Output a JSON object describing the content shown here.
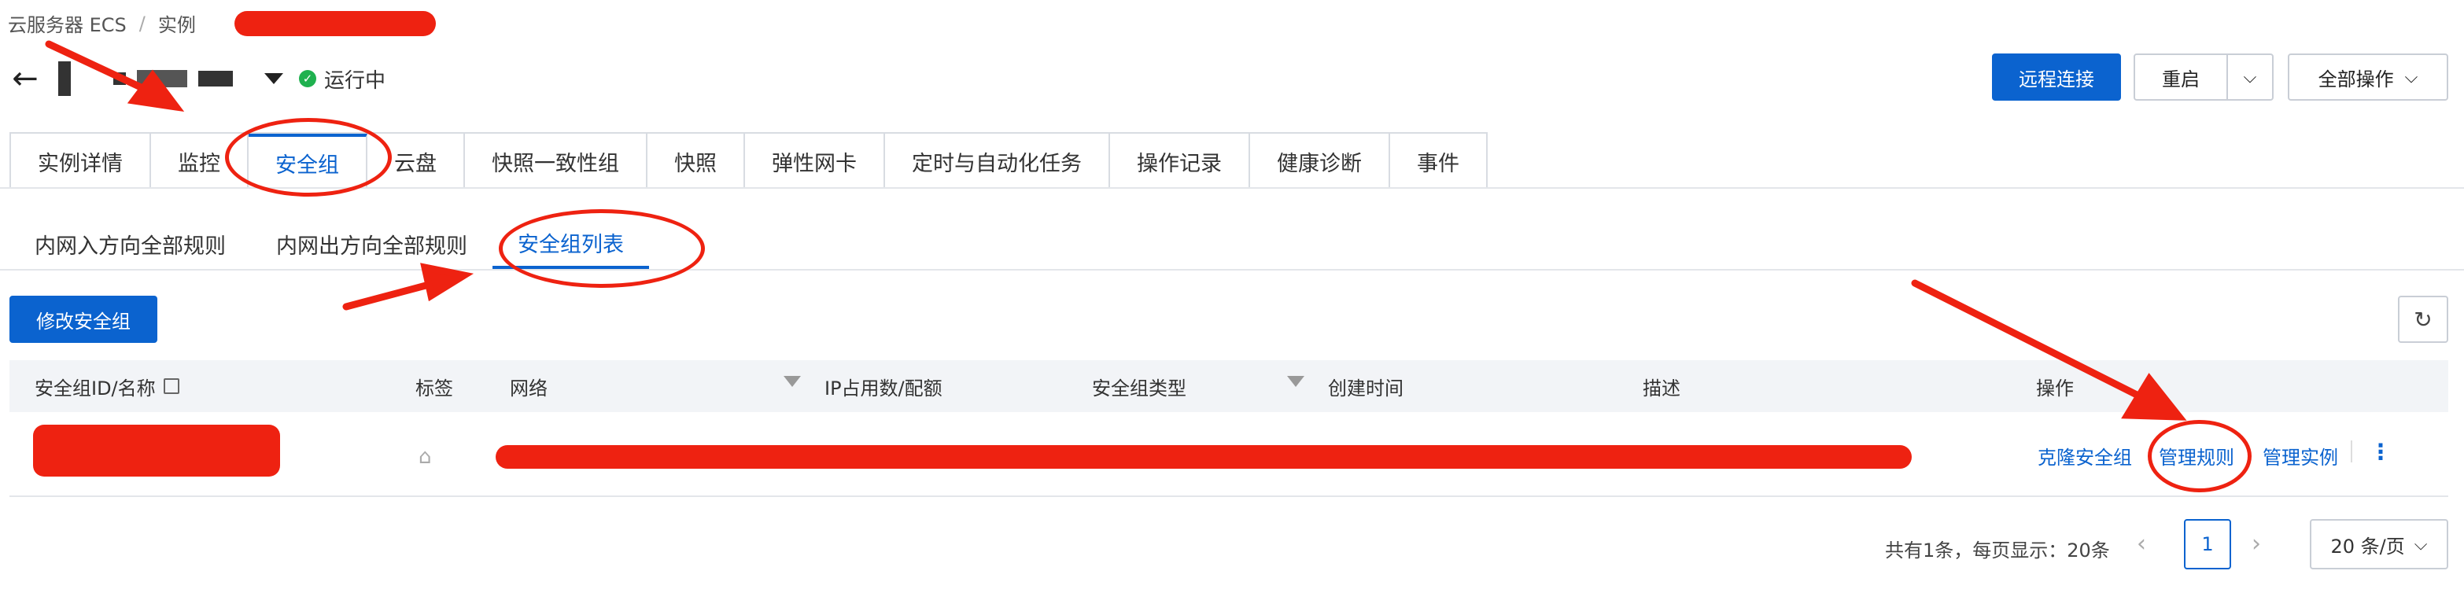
{
  "breadcrumb": {
    "service": "云服务器 ECS",
    "separator": "/",
    "current": "实例"
  },
  "instance": {
    "status": "运行中"
  },
  "header_actions": {
    "remote_connect": "远程连接",
    "restart": "重启",
    "all_actions": "全部操作"
  },
  "tabs": [
    "实例详情",
    "监控",
    "安全组",
    "云盘",
    "快照一致性组",
    "快照",
    "弹性网卡",
    "定时与自动化任务",
    "操作记录",
    "健康诊断",
    "事件"
  ],
  "active_tab": "安全组",
  "subtabs": [
    "内网入方向全部规则",
    "内网出方向全部规则",
    "安全组列表"
  ],
  "active_subtab": "安全组列表",
  "toolbar": {
    "modify_sg": "修改安全组"
  },
  "table": {
    "headers": {
      "id_name": "安全组ID/名称",
      "tags": "标签",
      "network": "网络",
      "ip_usage": "IP占用数/配额",
      "sg_type": "安全组类型",
      "created": "创建时间",
      "description": "描述",
      "actions": "操作"
    },
    "row_actions": {
      "clone": "克隆安全组",
      "manage_rules": "管理规则",
      "manage_instances": "管理实例",
      "more": "⋮"
    }
  },
  "pagination": {
    "summary": "共有1条，每页显示：20条",
    "current_page": "1",
    "page_size": "20 条/页"
  },
  "colors": {
    "accent": "#0b63cf",
    "annotation": "#ee2211",
    "running": "#1fb14f"
  }
}
